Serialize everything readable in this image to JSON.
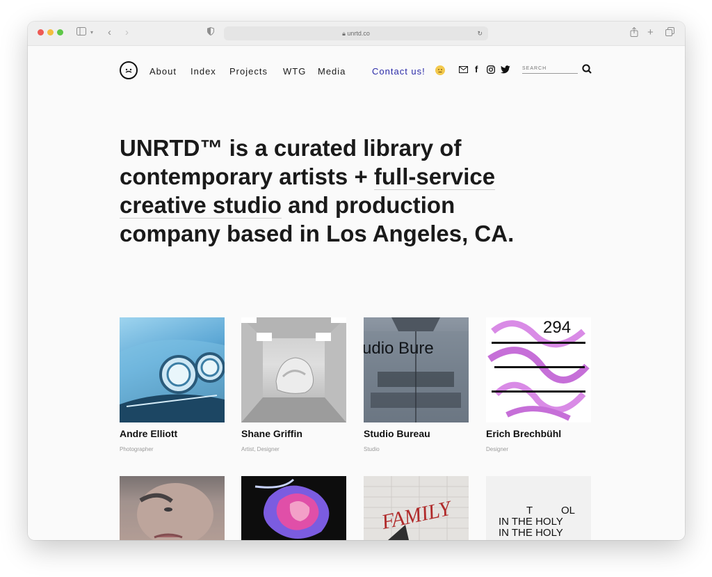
{
  "browser": {
    "url": "unrtd.co",
    "dot_colors": [
      "#ee5a55",
      "#f4bd3f",
      "#5ec748"
    ]
  },
  "nav": {
    "items": [
      "About",
      "Index",
      "Projects",
      "WTG",
      "Media"
    ],
    "contact": "Contact us!",
    "search_placeholder": "SEARCH"
  },
  "hero": {
    "part1": "UNRTD™ is a curated library of contemporary artists + ",
    "link": "full-service creative studio",
    "part2": " and production company based in Los Angeles, CA."
  },
  "artists": [
    {
      "name": "Andre Elliott",
      "role": "Photographer"
    },
    {
      "name": "Shane Griffin",
      "role": "Artist, Designer"
    },
    {
      "name": "Studio Bureau",
      "role": "Studio"
    },
    {
      "name": "Erich Brechbühl",
      "role": "Designer"
    }
  ],
  "artwork_text": {
    "studio_bureau": "udio Bure",
    "family": "FAMILY",
    "holy_col1": "T",
    "holy_col2": "OL",
    "holy_line": "IN THE HOLY",
    "erich_numbers": "294"
  },
  "colors": {
    "accent": "#2b2ba8",
    "text": "#1a1a1a",
    "muted": "#9a9a9a"
  }
}
